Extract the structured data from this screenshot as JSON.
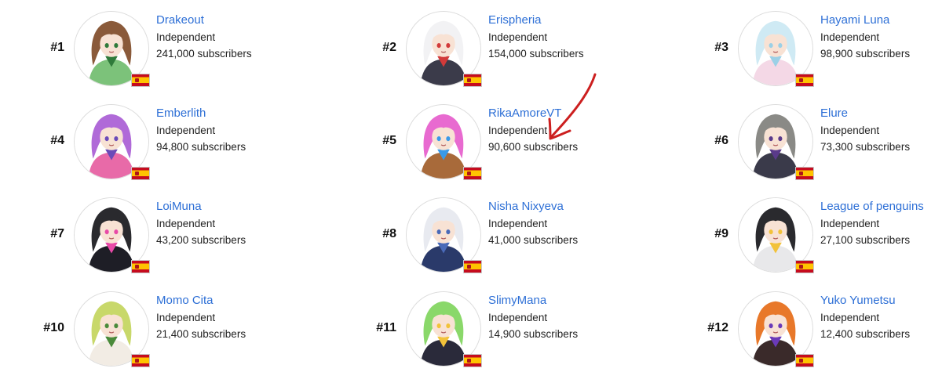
{
  "channels": [
    {
      "rank": "#1",
      "name": "Drakeout",
      "affiliation": "Independent",
      "subscribers": "241,000 subscribers",
      "hair": "#8a5a3a",
      "outfit": "#7cc27a",
      "accent": "#2f7a3a"
    },
    {
      "rank": "#2",
      "name": "Erispheria",
      "affiliation": "Independent",
      "subscribers": "154,000 subscribers",
      "hair": "#f2f2f4",
      "outfit": "#3b3b4a",
      "accent": "#d23a3a"
    },
    {
      "rank": "#3",
      "name": "Hayami Luna",
      "affiliation": "Independent",
      "subscribers": "98,900 subscribers",
      "hair": "#cfeaf4",
      "outfit": "#f4d8e6",
      "accent": "#9bd0e6"
    },
    {
      "rank": "#4",
      "name": "Emberlith",
      "affiliation": "Independent",
      "subscribers": "94,800 subscribers",
      "hair": "#b06ad8",
      "outfit": "#e86aa8",
      "accent": "#6a4ab8"
    },
    {
      "rank": "#5",
      "name": "RikaAmoreVT",
      "affiliation": "Independent",
      "subscribers": "90,600 subscribers",
      "hair": "#e86ad0",
      "outfit": "#a86a3a",
      "accent": "#3a9ae8"
    },
    {
      "rank": "#6",
      "name": "Elure",
      "affiliation": "Independent",
      "subscribers": "73,300 subscribers",
      "hair": "#8a8a86",
      "outfit": "#3a3a4a",
      "accent": "#5a3a8a"
    },
    {
      "rank": "#7",
      "name": "LoiMuna",
      "affiliation": "Independent",
      "subscribers": "43,200 subscribers",
      "hair": "#2a2a2e",
      "outfit": "#1e1e26",
      "accent": "#e84aa8"
    },
    {
      "rank": "#8",
      "name": "Nisha Nixyeva",
      "affiliation": "Independent",
      "subscribers": "41,000 subscribers",
      "hair": "#e8eaf0",
      "outfit": "#2a3a6a",
      "accent": "#4a6ab8"
    },
    {
      "rank": "#9",
      "name": "League of penguins",
      "affiliation": "Independent",
      "subscribers": "27,100 subscribers",
      "hair": "#2a2a2e",
      "outfit": "#e8e8ea",
      "accent": "#f2c23a"
    },
    {
      "rank": "#10",
      "name": "Momo Cita",
      "affiliation": "Independent",
      "subscribers": "21,400 subscribers",
      "hair": "#c8d86a",
      "outfit": "#f2ece4",
      "accent": "#4a8a3a"
    },
    {
      "rank": "#11",
      "name": "SlimyMana",
      "affiliation": "Independent",
      "subscribers": "14,900 subscribers",
      "hair": "#8ad86a",
      "outfit": "#2a2a3a",
      "accent": "#f2c23a"
    },
    {
      "rank": "#12",
      "name": "Yuko Yumetsu",
      "affiliation": "Independent",
      "subscribers": "12,400 subscribers",
      "hair": "#e8782a",
      "outfit": "#3a2a2a",
      "accent": "#6a3ab8"
    }
  ],
  "flag_icon": "spain-flag-icon",
  "annotation": {
    "icon": "red-hand-drawn-arrow-icon",
    "color": "#cc1f1f"
  }
}
